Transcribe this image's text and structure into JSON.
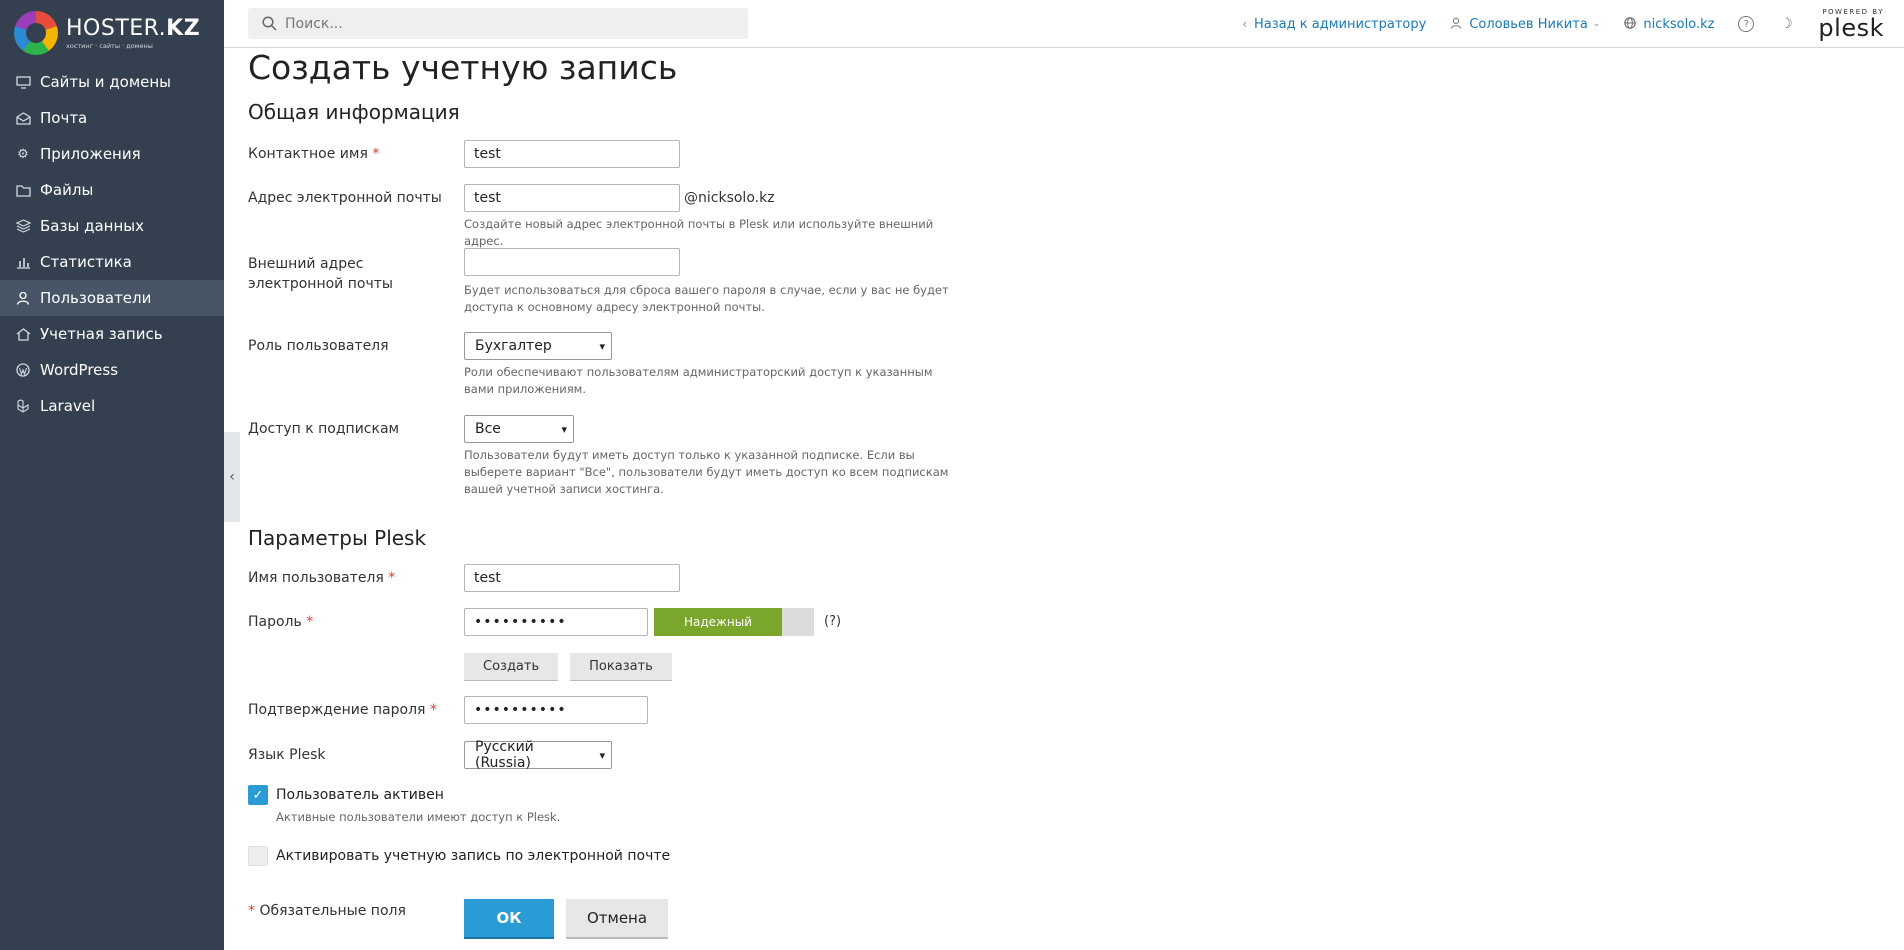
{
  "brand": {
    "name_light": "HOSTER.",
    "name_bold": "KZ",
    "tagline": "хостинг · сайты · домены"
  },
  "sidebar": {
    "items": [
      {
        "label": "Сайты и домены",
        "icon": "monitor-icon"
      },
      {
        "label": "Почта",
        "icon": "mail-icon"
      },
      {
        "label": "Приложения",
        "icon": "gear-icon"
      },
      {
        "label": "Файлы",
        "icon": "folder-icon"
      },
      {
        "label": "Базы данных",
        "icon": "database-icon"
      },
      {
        "label": "Статистика",
        "icon": "bar-chart-icon"
      },
      {
        "label": "Пользователи",
        "icon": "user-icon",
        "active": true
      },
      {
        "label": "Учетная запись",
        "icon": "account-icon"
      },
      {
        "label": "WordPress",
        "icon": "wordpress-icon"
      },
      {
        "label": "Laravel",
        "icon": "laravel-icon"
      }
    ]
  },
  "topbar": {
    "search_placeholder": "Поиск...",
    "back_link": "Назад к администратору",
    "user_name": "Соловьев Никита",
    "domain": "nicksolo.kz",
    "powered_by": "POWERED BY",
    "plesk": "plesk"
  },
  "page": {
    "title": "Создать учетную запись"
  },
  "general": {
    "title": "Общая информация",
    "contact_label": "Контактное имя",
    "contact_value": "test",
    "email_label": "Адрес электронной почты",
    "email_value": "test",
    "email_domain": "@nicksolo.kz",
    "email_hint": "Создайте новый адрес электронной почты в Plesk или используйте внешний адрес.",
    "ext_email_label": "Внешний адрес электронной почты",
    "ext_email_value": "",
    "ext_email_hint": "Будет использоваться для сброса вашего пароля в случае, если у вас не будет доступа к основному адресу электронной почты.",
    "role_label": "Роль пользователя",
    "role_value": "Бухгалтер",
    "role_hint": "Роли обеспечивают пользователям администраторский доступ к указанным вами приложениям.",
    "subs_label": "Доступ к подпискам",
    "subs_value": "Все",
    "subs_hint": "Пользователи будут иметь доступ только к указанной подписке. Если вы выберете вариант \"Все\", пользователи будут иметь доступ ко всем подпискам вашей учетной записи хостинга."
  },
  "plesk_params": {
    "title": "Параметры Plesk",
    "username_label": "Имя пользователя",
    "username_value": "test",
    "password_label": "Пароль",
    "password_value": "••••••••••",
    "strength_label": "Надежный",
    "strength_fraction": 0.8,
    "strength_help": "(?)",
    "generate_button": "Создать",
    "show_button": "Показать",
    "confirm_label": "Подтверждение пароля",
    "confirm_value": "••••••••••",
    "lang_label": "Язык Plesk",
    "lang_value": "Русский (Russia)",
    "active_label": "Пользователь активен",
    "active_checked": true,
    "active_hint": "Активные пользователи имеют доступ к Plesk.",
    "activate_email_label": "Активировать учетную запись по электронной почте",
    "activate_email_checked": false
  },
  "footer": {
    "required_star": "*",
    "required_text": "Обязательные поля",
    "ok_button": "ОК",
    "cancel_button": "Отмена"
  },
  "required_mark": "*",
  "colors": {
    "sidebar_bg": "#34404f",
    "accent": "#2a9bd4",
    "strength_good": "#7aa62c",
    "link": "#1a7ab5"
  }
}
